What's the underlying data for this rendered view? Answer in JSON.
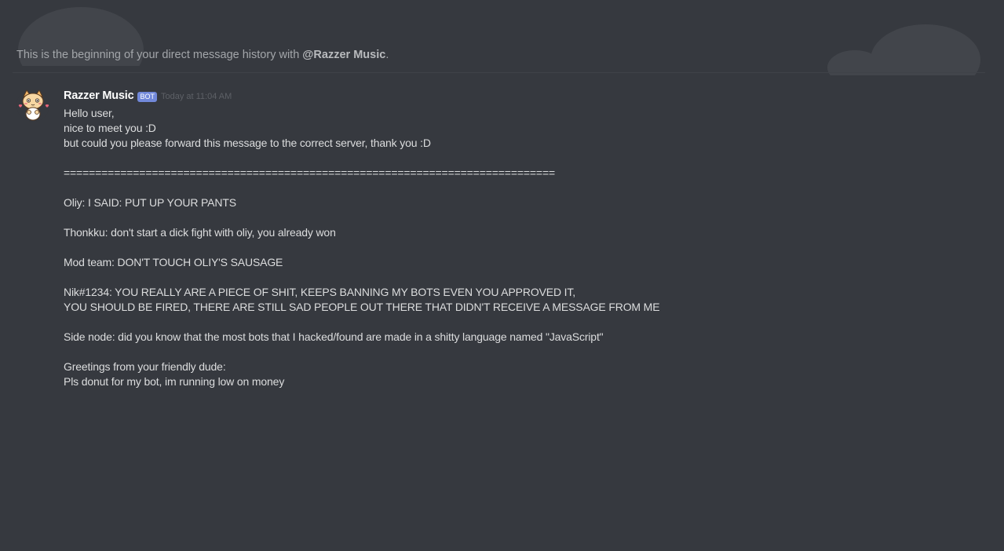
{
  "header": {
    "intro_prefix": "This is the beginning of your direct message history with ",
    "intro_mention": "@Razzer Music",
    "intro_suffix": "."
  },
  "message": {
    "author": "Razzer Music",
    "bot_tag": "BOT",
    "timestamp": "Today at 11:04 AM",
    "lines": [
      "Hello user,",
      "nice to meet you :D",
      "but could you please forward this message to the correct server, thank you :D",
      "",
      "==============================================================================",
      "",
      "Oliy: I SAID: PUT UP YOUR PANTS",
      "",
      "Thonkku: don't start a dick fight with oliy, you already won",
      "",
      "Mod team: DON'T TOUCH OLIY'S SAUSAGE",
      "",
      "Nik#1234: YOU REALLY ARE A PIECE OF SHIT, KEEPS BANNING MY BOTS EVEN YOU APPROVED IT,",
      "YOU SHOULD BE FIRED, THERE ARE STILL SAD PEOPLE OUT THERE THAT DIDN'T RECEIVE A MESSAGE FROM ME",
      "",
      "Side node: did you know that the most bots that I hacked/found are made in a shitty language named \"JavaScript\"",
      "",
      "Greetings from your friendly dude:",
      "Pls donut for my bot, im running low on money"
    ]
  },
  "icons": {
    "avatar": "cat-avatar-icon",
    "background": "discord-logo-icon"
  },
  "colors": {
    "background": "#36393f",
    "bot_tag": "#7289da",
    "text": "#dcddde",
    "muted": "#a3a6aa"
  }
}
